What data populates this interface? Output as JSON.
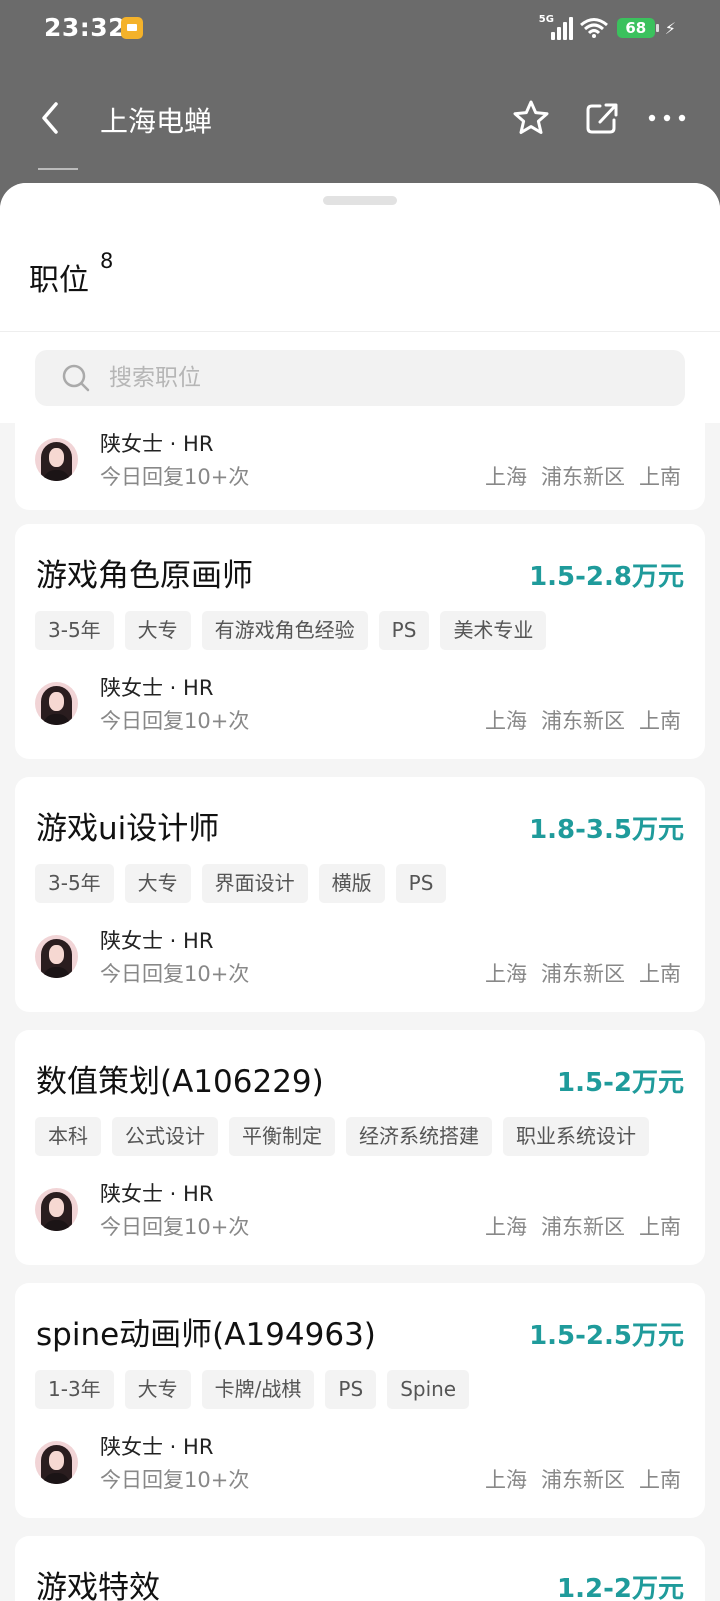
{
  "status_bar": {
    "time": "23:32",
    "network": "5G",
    "battery": "68"
  },
  "header": {
    "title": "上海电蝉"
  },
  "sheet": {
    "title": "职位",
    "count": "8",
    "search": {
      "placeholder": "搜索职位",
      "value": ""
    }
  },
  "jobs": [
    {
      "title": "",
      "salary": "",
      "tags": [],
      "recruiter": {
        "name": "陕女士 · HR",
        "reply": "今日回复10+次"
      },
      "location": [
        "上海",
        "浦东新区",
        "上南"
      ]
    },
    {
      "title": "游戏角色原画师",
      "salary": "1.5-2.8万元",
      "tags": [
        "3-5年",
        "大专",
        "有游戏角色经验",
        "PS",
        "美术专业"
      ],
      "recruiter": {
        "name": "陕女士 · HR",
        "reply": "今日回复10+次"
      },
      "location": [
        "上海",
        "浦东新区",
        "上南"
      ]
    },
    {
      "title": "游戏ui设计师",
      "salary": "1.8-3.5万元",
      "tags": [
        "3-5年",
        "大专",
        "界面设计",
        "横版",
        "PS"
      ],
      "recruiter": {
        "name": "陕女士 · HR",
        "reply": "今日回复10+次"
      },
      "location": [
        "上海",
        "浦东新区",
        "上南"
      ]
    },
    {
      "title": "数值策划(A106229)",
      "salary": "1.5-2万元",
      "tags": [
        "本科",
        "公式设计",
        "平衡制定",
        "经济系统搭建",
        "职业系统设计"
      ],
      "recruiter": {
        "name": "陕女士 · HR",
        "reply": "今日回复10+次"
      },
      "location": [
        "上海",
        "浦东新区",
        "上南"
      ]
    },
    {
      "title": "spine动画师(A194963)",
      "salary": "1.5-2.5万元",
      "tags": [
        "1-3年",
        "大专",
        "卡牌/战棋",
        "PS",
        "Spine"
      ],
      "recruiter": {
        "name": "陕女士 · HR",
        "reply": "今日回复10+次"
      },
      "location": [
        "上海",
        "浦东新区",
        "上南"
      ]
    },
    {
      "title": "游戏特效",
      "salary": "1.2-2万元",
      "tags": [],
      "recruiter": null,
      "location": []
    }
  ],
  "colors": {
    "salary": "#1f9b9b",
    "overlay": "#6b6b6b",
    "battery": "#3bc15d"
  }
}
